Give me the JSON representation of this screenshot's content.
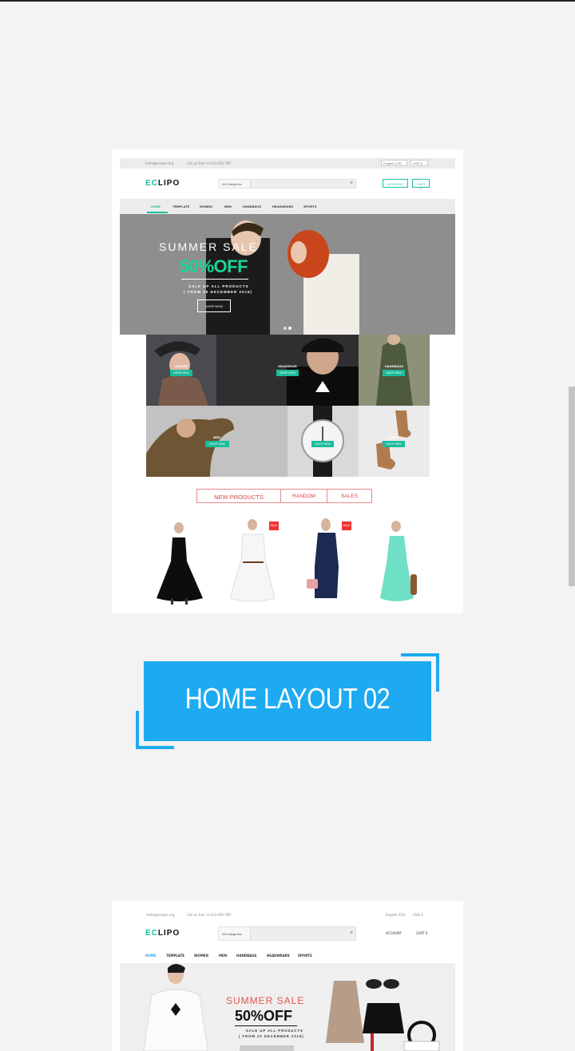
{
  "preview1": {
    "topbar": {
      "email": "hello@eclipse.org",
      "call": "Call us free: 0-123-456-789",
      "lang": "English (US)",
      "currency": "USD $"
    },
    "logo": {
      "mark": "EC",
      "text": "LIPO"
    },
    "search": {
      "category": "All Categories",
      "icon": "search-icon"
    },
    "buttons": {
      "account": "ACCOUNT",
      "cart": "CART 0"
    },
    "nav": [
      "HOME",
      "TEMPLATE",
      "WOMEN",
      "MEN",
      "HANDBAGS",
      "HEADWEARS",
      "SPORTS"
    ],
    "hero": {
      "title": "SUMMER SALE",
      "discount": "50%OFF",
      "sub1": "SALE UP ALL PRODUCTS",
      "sub2": "( FROM 20 DECEMBER 2016)",
      "button": "SHOP NOW"
    },
    "categories": [
      {
        "label": "WOMEN",
        "button": "SHOP NOW"
      },
      {
        "label": "HEADWEAR",
        "button": "SHOP NOW"
      },
      {
        "label": "HANDBAGS",
        "button": "SHOP NOW"
      },
      {
        "label": "MEN",
        "button": "SHOP NOW"
      },
      {
        "label": "",
        "button": "SHOP NOW"
      },
      {
        "label": "SHOE",
        "button": "SHOP NOW"
      }
    ],
    "tabs": [
      "NEW PRODUCTS",
      "RANDOM",
      "SALES"
    ],
    "sale_badge": "SALE"
  },
  "layout_title": "HOME LAYOUT 02",
  "preview2": {
    "topbar": {
      "email": "hello@eclipse.org",
      "call": "Call us free: 0-123-456-789",
      "lang": "English (US)",
      "currency": "USD $"
    },
    "logo": {
      "mark": "EC",
      "text": "LIPO"
    },
    "search": {
      "category": "All Categories"
    },
    "buttons": {
      "account": "ACCOUNT",
      "cart": "CART 0"
    },
    "nav": [
      "HOME",
      "TEMPLATE",
      "WOMEN",
      "MEN",
      "HANDBAGS",
      "HEADWEARS",
      "SPORTS"
    ],
    "hero": {
      "title": "SUMMER SALE",
      "discount": "50%OFF",
      "sub1": "SALE UP ALL PRODUCTS",
      "sub2": "( FROM 20 DECEMBER 2016)"
    }
  },
  "colors": {
    "accent": "#1bbc9b",
    "title_bg": "#1eaaf1",
    "sale": "#e33333"
  }
}
